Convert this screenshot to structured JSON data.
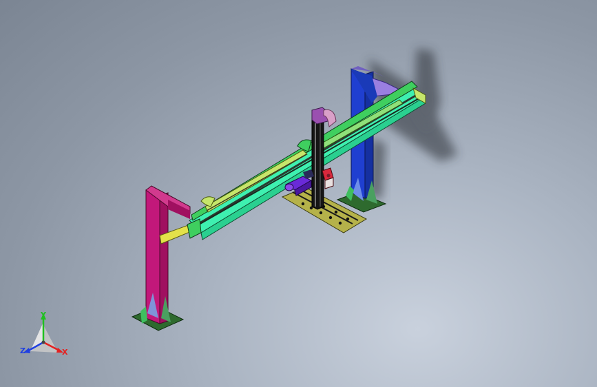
{
  "triad": {
    "x_label": "X",
    "y_label": "Y",
    "z_label": "Z"
  },
  "colors": {
    "left_column": "#c2187a",
    "right_column": "#1f3fd0",
    "right_cap": "#9a7fe0",
    "beam_green": "#3fcf5f",
    "beam_lime": "#c6e66b",
    "beam_mint": "#3ef0b0",
    "beam_dark": "#2a3a30",
    "carriage_purple": "#6a2ad8",
    "mast_black": "#151515",
    "pink_housing": "#d9a0c8",
    "red_motor": "#d8283c",
    "tray_olive": "#b5b24a",
    "yellow_brace": "#e3e14a",
    "base_plate": "#2e6a2e",
    "axis_x": "#e52020",
    "axis_y": "#20c020",
    "axis_z": "#2040e0"
  }
}
